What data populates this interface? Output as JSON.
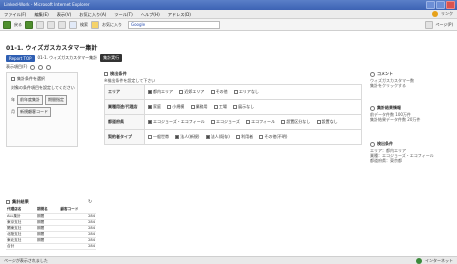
{
  "window": {
    "title": "Linked-Work - Microsoft Internet Explorer"
  },
  "menu": {
    "items": [
      "ファイル(F)",
      "編集(E)",
      "表示(V)",
      "お気に入り(A)",
      "ツール(T)",
      "ヘルプ(H)",
      "アドレス(D)"
    ],
    "right_label": "リンク"
  },
  "toolbar": {
    "back": "戻る",
    "search_label": "検索",
    "favorites_label": "お気に入り",
    "search_value": "Google",
    "right_label": "ページ(P)"
  },
  "page": {
    "title": "01-1. ウィズガスカスタマー集計",
    "crumb1": "Report TOP",
    "crumb2": "01-1. ウィズガスカスタマー集計",
    "crumb3": "集計実行",
    "subrow_label": "表示項目(F)"
  },
  "left_panel": {
    "title": "集計条件を選択",
    "hint": "対象の条件項目を設定してください",
    "row1_key": "年",
    "row1_btn1": "前年度集計",
    "row1_btn2": "期間指定",
    "row2_key": "月",
    "row2_btn": "新規顧客コード"
  },
  "center": {
    "header": "検出条件",
    "sub": "※検出条件を設定して下さい",
    "rows": [
      {
        "key": "エリア",
        "opts": [
          "都内エリア",
          "近郊エリア",
          "その他",
          "エリアなし"
        ]
      },
      {
        "key": "業種用途/代理店",
        "opts": [
          "家庭",
          "小規模",
          "業務用",
          "工場",
          "展示なし"
        ]
      },
      {
        "key": "都道府県",
        "opts": [
          "エコジョーズ・エコフィール",
          "エコジョーズ",
          "エコフィール",
          "設置区分なし",
          "設置なし"
        ]
      },
      {
        "key": "契約者タイプ",
        "opts": [
          "一般世帯",
          "法人(新規)",
          "法人(既存)",
          "利用者",
          "その他(不明)"
        ]
      }
    ]
  },
  "right_panel": {
    "items": [
      {
        "head": "コメント",
        "body": "ウィズガスカスタマー数\n集計をクリックする"
      },
      {
        "head": "集計結果情報",
        "body": "前データ件数 100万件\n集計結果データ件数 20万件"
      },
      {
        "head": "検出条件",
        "body": "エリア：都内エリア\n業種：エコジョーズ・エコフィール\n都道府県：東京都"
      }
    ]
  },
  "results": {
    "title": "集計結果",
    "headers": [
      "代理店名",
      "期間名",
      "顧客コード"
    ],
    "rows": [
      [
        "ALL集計",
        "期間",
        "284"
      ],
      [
        "東京支社",
        "期間",
        "284"
      ],
      [
        "関東支社",
        "期間",
        "284"
      ],
      [
        "北陸支社",
        "期間",
        "284"
      ],
      [
        "東北支社",
        "期間",
        "284"
      ],
      [
        "合計",
        "",
        "284"
      ]
    ]
  },
  "status": {
    "left": "ページが表示されました",
    "right": "インターネット"
  },
  "colors": {
    "accent": "#2f5fb3",
    "titlebar": "#3d63b4"
  }
}
